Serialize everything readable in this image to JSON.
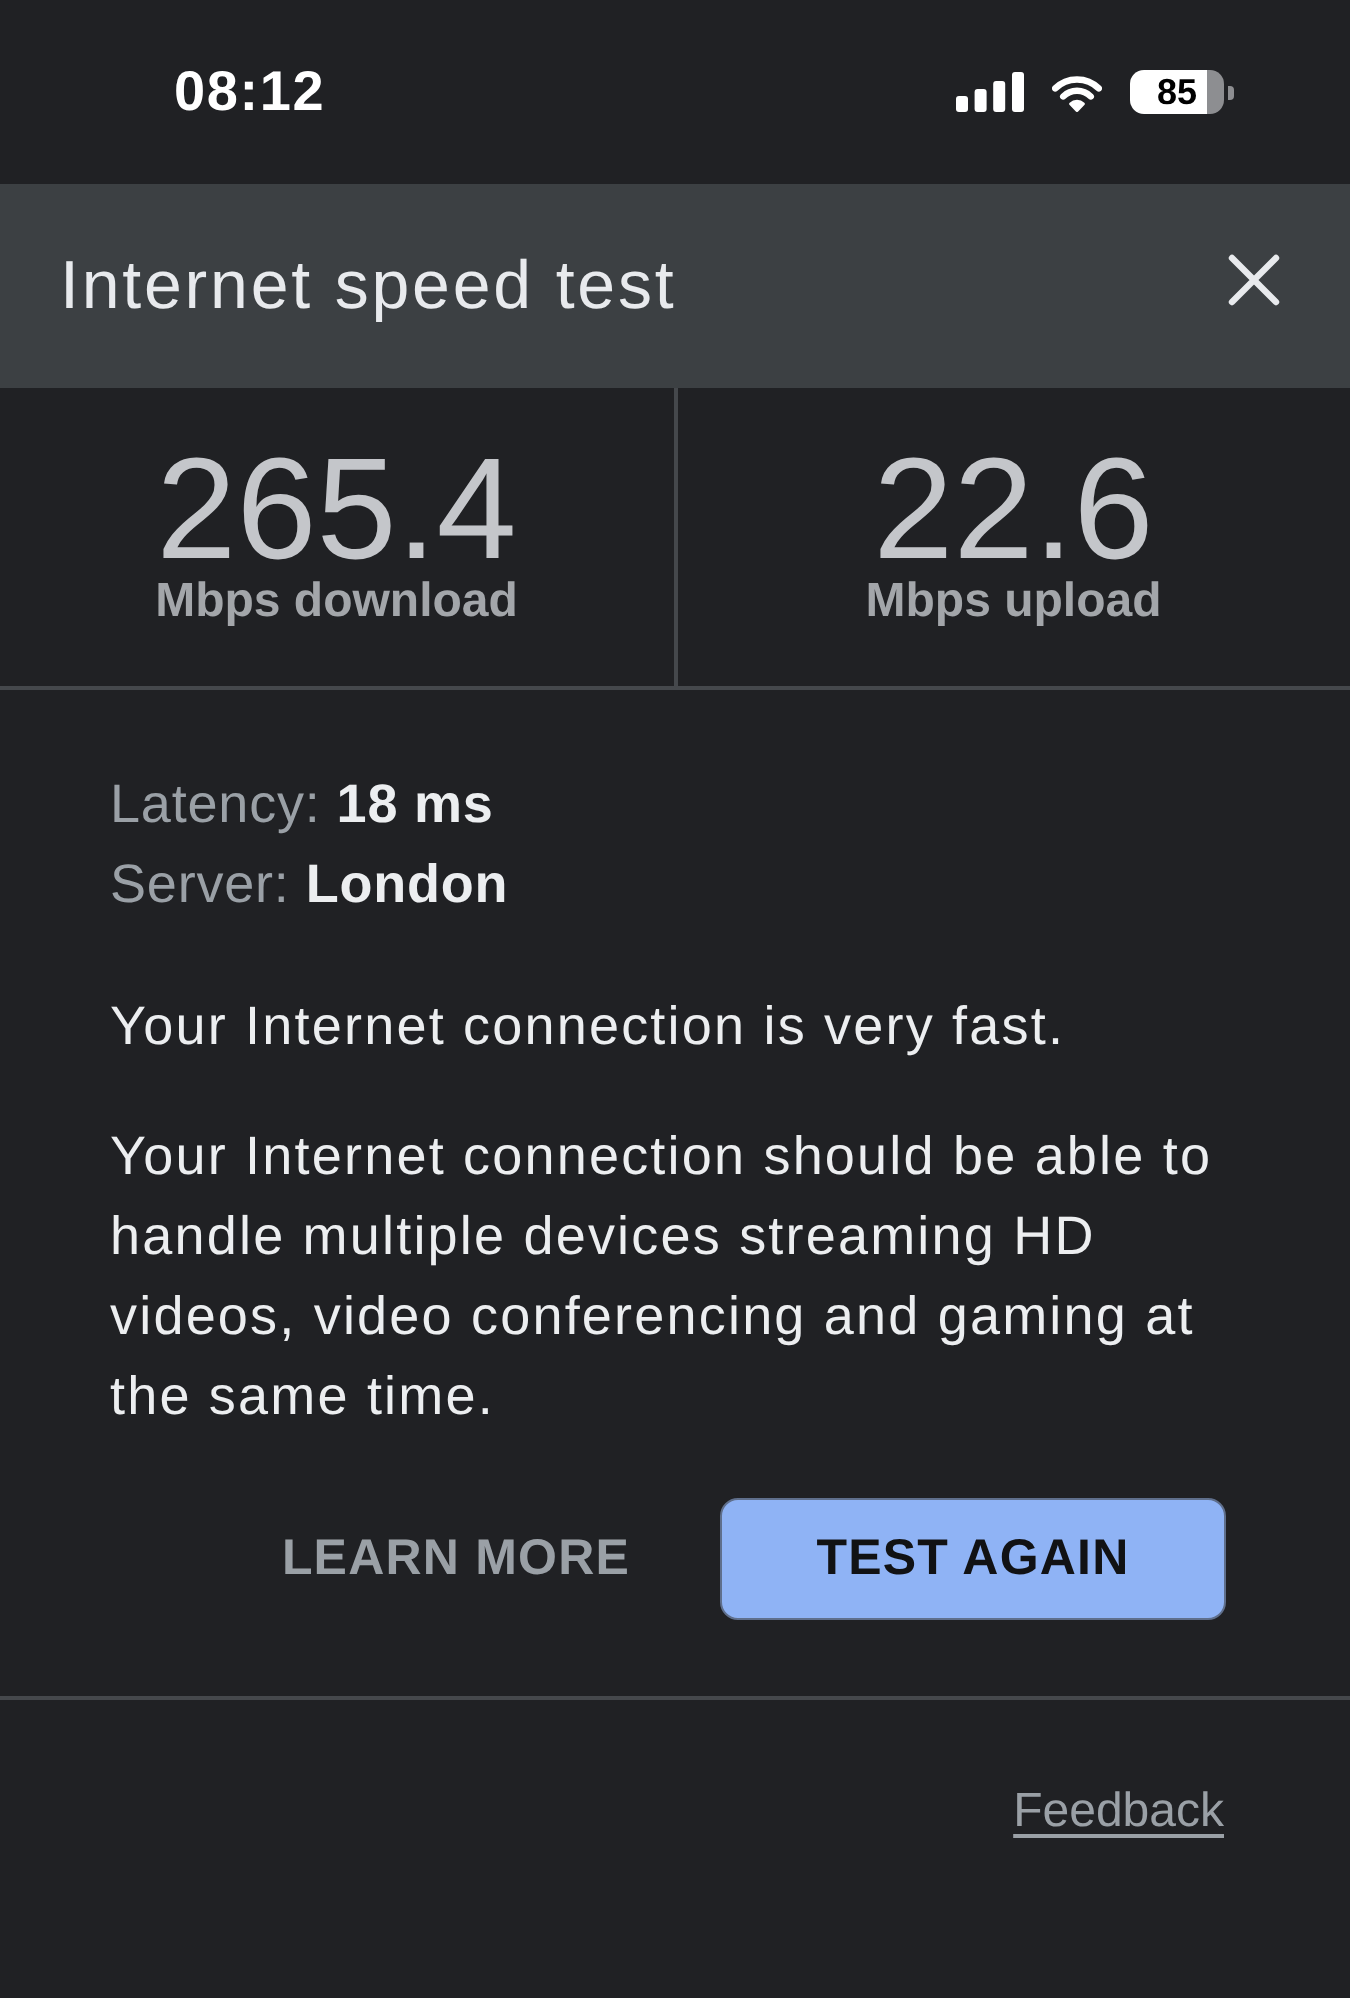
{
  "status_bar": {
    "time": "08:12",
    "battery": "85"
  },
  "header": {
    "title": "Internet speed test"
  },
  "results": [
    {
      "value": "265.4",
      "label": "Mbps download"
    },
    {
      "value": "22.6",
      "label": "Mbps upload"
    }
  ],
  "details": [
    {
      "label": "Latency:",
      "value": "18 ms"
    },
    {
      "label": "Server:",
      "value": "London"
    }
  ],
  "summary": "Your Internet connection is very fast.",
  "description": "Your Internet connection should be able to handle multiple devices streaming HD videos, video conferencing and gaming at the same time.",
  "actions": [
    {
      "label": "LEARN MORE",
      "kind": "text"
    },
    {
      "label": "TEST AGAIN",
      "kind": "filled"
    }
  ],
  "feedback_link": "Feedback"
}
